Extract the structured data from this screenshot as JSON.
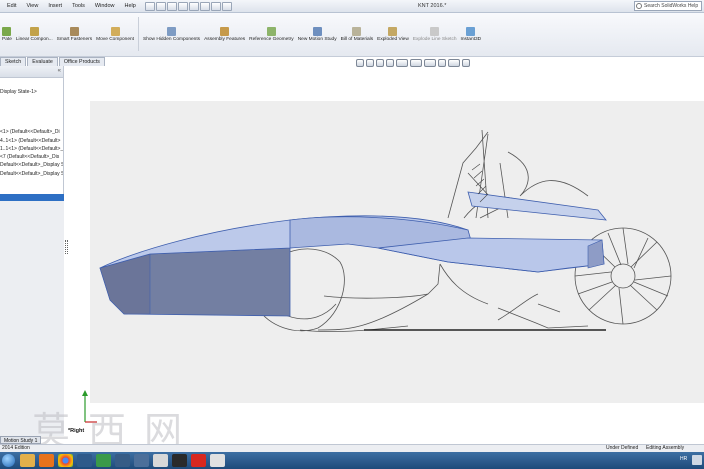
{
  "menu": [
    "Edit",
    "View",
    "Insert",
    "Tools",
    "Window",
    "Help"
  ],
  "document_title": "KNT 2016.*",
  "help_search": {
    "placeholder": "Search SolidWorks Help"
  },
  "command_manager": [
    {
      "label": "Pate",
      "icon": "mate-icon"
    },
    {
      "label": "Linear Compon...",
      "icon": "linear-pattern-icon"
    },
    {
      "label": "Smart Fasteners",
      "icon": "smart-fasteners-icon"
    },
    {
      "label": "Move Component",
      "icon": "move-component-icon"
    },
    {
      "label": "Show Hidden Components",
      "icon": "show-hidden-icon"
    },
    {
      "label": "Assembly Features",
      "icon": "assembly-features-icon"
    },
    {
      "label": "Reference Geometry",
      "icon": "reference-geometry-icon"
    },
    {
      "label": "New Motion Study",
      "icon": "motion-study-icon"
    },
    {
      "label": "Bill of Materials",
      "icon": "bill-of-materials-icon"
    },
    {
      "label": "Exploded View",
      "icon": "exploded-view-icon"
    },
    {
      "label": "Explode Line Sketch",
      "icon": "explode-line-icon"
    },
    {
      "label": "Instant3D",
      "icon": "instant3d-icon"
    }
  ],
  "tabs": [
    "Sketch",
    "Evaluate",
    "Office Products"
  ],
  "feature_tree": {
    "display_state": "Display State-1>",
    "nodes": [
      "<1> (Default<<Default>_Di",
      "4..1<1> (Default<<Default>",
      "1..1<1> (Default<<Default>_",
      "<7 (Default<<Default>_Dis",
      "Default<<Default>_Display State-1>",
      "Default<<Default>_Display Sta"
    ]
  },
  "triad": {
    "label": "*Right"
  },
  "watermark": [
    "莫",
    "西",
    "网"
  ],
  "bottom_tabs": [
    "Motion Study 1"
  ],
  "status": {
    "edition": "2014 Edition",
    "definition": "Under Defined",
    "mode": "Editing Assembly"
  },
  "taskbar": {
    "apps": [
      "explorer-icon",
      "media-icon",
      "chrome-icon",
      "app-icon",
      "app-icon",
      "network-icon",
      "app-icon",
      "folder-icon",
      "wps-icon",
      "solidworks-icon",
      "paint-icon"
    ],
    "language": "HR"
  },
  "colors": {
    "accent": "#2d6fc4",
    "model_face": "#b7c6e6",
    "model_dark": "#6a7aa8",
    "taskbar": "#1e4a7a"
  }
}
